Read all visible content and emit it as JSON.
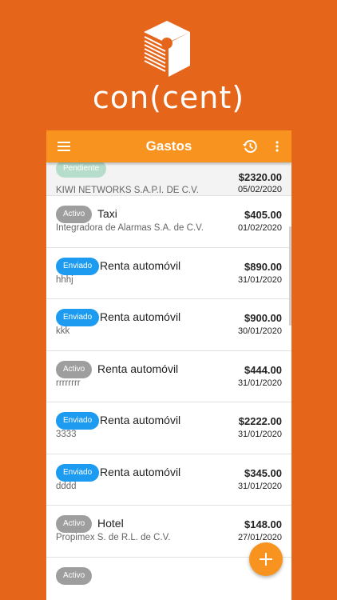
{
  "brand": {
    "name": "con(cent)"
  },
  "header": {
    "title": "Gastos"
  },
  "icons": {
    "menu": "hamburger-menu-icon",
    "history": "history-icon",
    "more": "more-vertical-icon",
    "add": "plus-icon",
    "logo": "concent-cube-logo"
  },
  "colors": {
    "background": "#e5661a",
    "app_bar": "#f7931e",
    "badge_pendiente": "#b6dccb",
    "badge_activo": "#9e9e9e",
    "badge_enviado": "#1d9bf0"
  },
  "expenses": [
    {
      "status": "Pendiente",
      "concept": "",
      "subtitle": "KIWI NETWORKS S.A.P.I. DE C.V.",
      "amount": "$2320.00",
      "date": "05/02/2020"
    },
    {
      "status": "Activo",
      "concept": "Taxi",
      "subtitle": "Integradora de Alarmas S.A. de C.V.",
      "amount": "$405.00",
      "date": "01/02/2020"
    },
    {
      "status": "Enviado",
      "concept": "Renta automóvil",
      "subtitle": "hhhj",
      "amount": "$890.00",
      "date": "31/01/2020"
    },
    {
      "status": "Enviado",
      "concept": "Renta automóvil",
      "subtitle": "kkk",
      "amount": "$900.00",
      "date": "30/01/2020"
    },
    {
      "status": "Activo",
      "concept": "Renta automóvil",
      "subtitle": "rrrrrrrr",
      "amount": "$444.00",
      "date": "31/01/2020"
    },
    {
      "status": "Enviado",
      "concept": "Renta automóvil",
      "subtitle": "3333",
      "amount": "$2222.00",
      "date": "31/01/2020"
    },
    {
      "status": "Enviado",
      "concept": "Renta automóvil",
      "subtitle": "dddd",
      "amount": "$345.00",
      "date": "31/01/2020"
    },
    {
      "status": "Activo",
      "concept": "Hotel",
      "subtitle": "Propimex S. de R.L. de C.V.",
      "amount": "$148.00",
      "date": "27/01/2020"
    },
    {
      "status": "Activo",
      "concept": "",
      "subtitle": "",
      "amount": "",
      "date": ""
    }
  ]
}
